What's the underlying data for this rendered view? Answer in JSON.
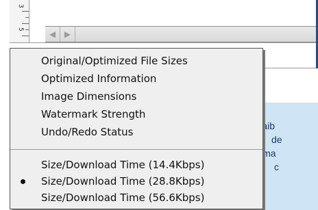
{
  "ruler": {
    "digits": [
      "3",
      "5"
    ]
  },
  "scroll": {
    "left_arrow": "◀",
    "right_arrow": "▶"
  },
  "menu": {
    "items": [
      {
        "label": "Original/Optimized File Sizes"
      },
      {
        "label": "Optimized Information"
      },
      {
        "label": "Image Dimensions"
      },
      {
        "label": "Watermark Strength"
      },
      {
        "label": "Undo/Redo Status"
      }
    ],
    "speed_items": [
      {
        "label": "Size/Download Time (14.4Kbps)",
        "checked": false
      },
      {
        "label": "Size/Download Time (28.8Kbps)",
        "checked": true
      },
      {
        "label": "Size/Download Time (56.6Kbps)",
        "checked": false
      }
    ]
  },
  "note": {
    "lines": [
      "Saib",
      "de",
      "ima",
      "c"
    ],
    "color": "#cfe4f4"
  }
}
